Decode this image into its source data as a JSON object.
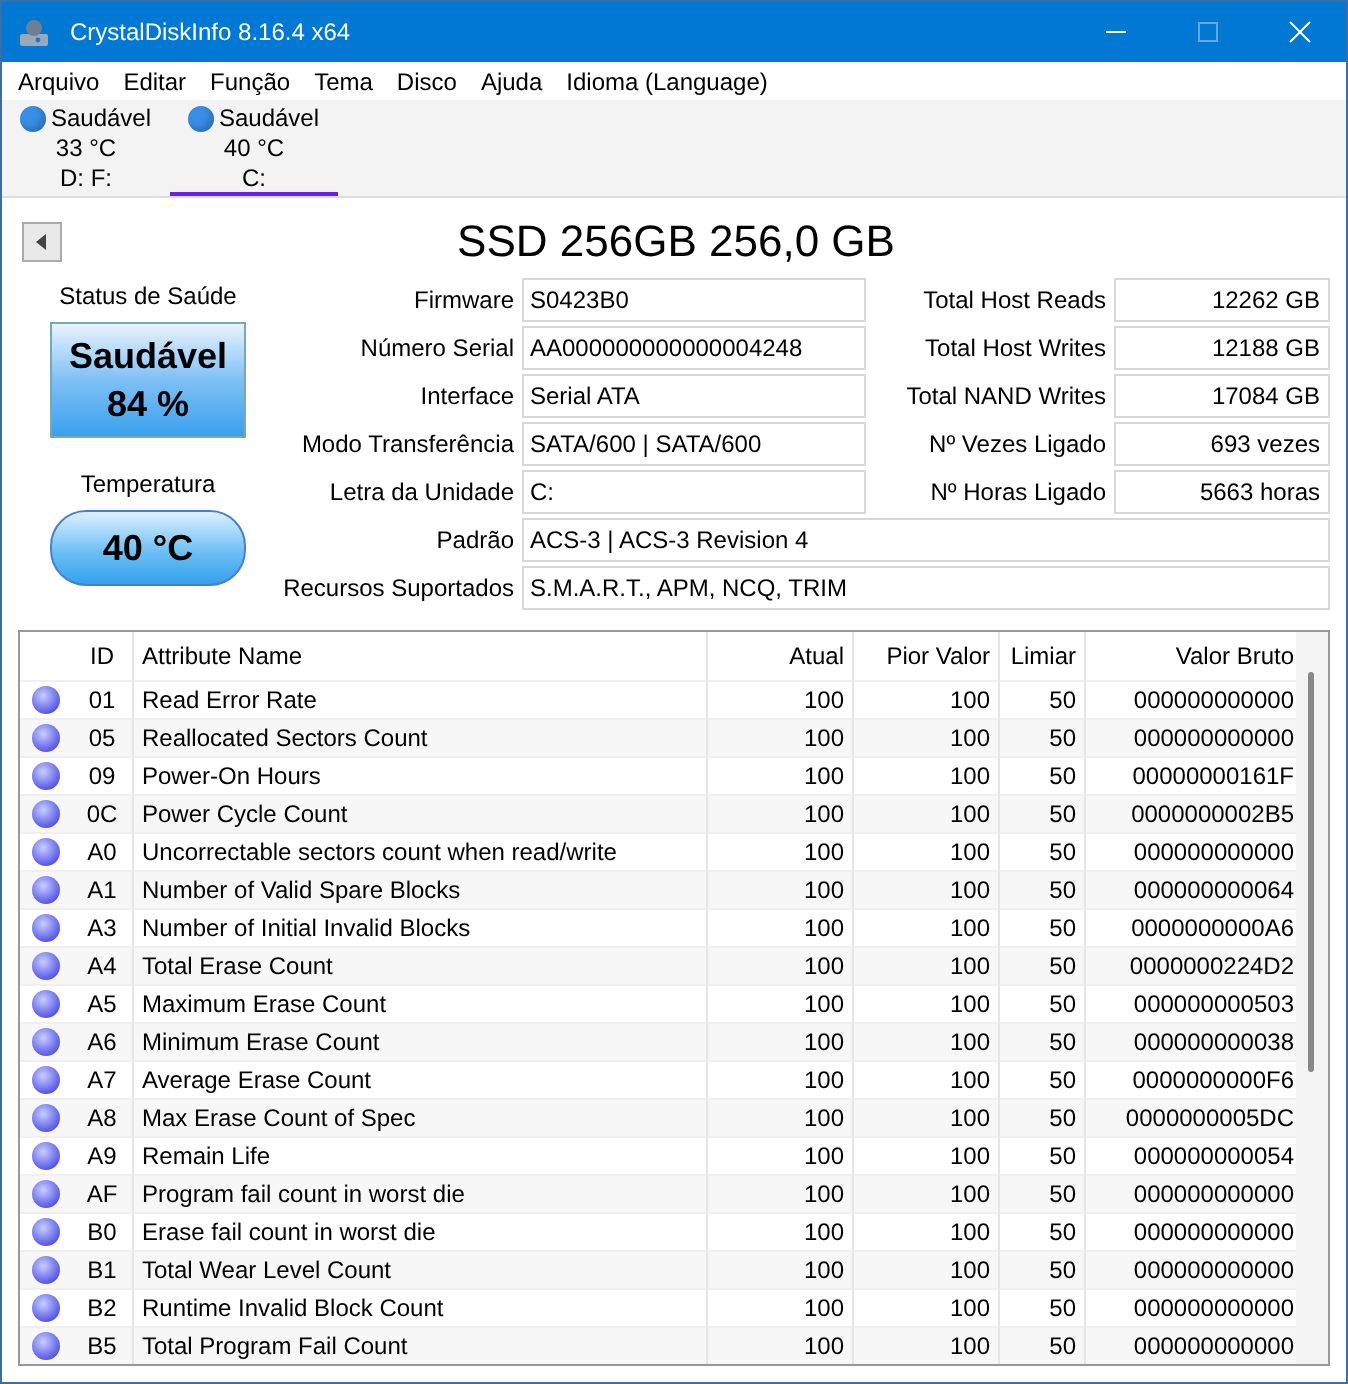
{
  "window": {
    "title": "CrystalDiskInfo 8.16.4 x64"
  },
  "menu": [
    "Arquivo",
    "Editar",
    "Função",
    "Tema",
    "Disco",
    "Ajuda",
    "Idioma (Language)"
  ],
  "drives": [
    {
      "status": "Saudável",
      "temperature": "33 °C",
      "letters": "D: F:",
      "color": "#3a8ee6",
      "selected": false
    },
    {
      "status": "Saudável",
      "temperature": "40 °C",
      "letters": "C:",
      "color": "#3a8ee6",
      "selected": true
    }
  ],
  "disk_title": "SSD 256GB 256,0 GB",
  "health": {
    "label": "Status de Saúde",
    "status": "Saudável",
    "percent": "84 %"
  },
  "temperature": {
    "label": "Temperatura",
    "value": "40 °C"
  },
  "info_left": [
    {
      "label": "Firmware",
      "value": "S0423B0"
    },
    {
      "label": "Número Serial",
      "value": "AA000000000000004248"
    },
    {
      "label": "Interface",
      "value": "Serial ATA"
    },
    {
      "label": "Modo Transferência",
      "value": "SATA/600 | SATA/600"
    },
    {
      "label": "Letra da Unidade",
      "value": "C:"
    }
  ],
  "info_right": [
    {
      "label": "Total Host Reads",
      "value": "12262 GB"
    },
    {
      "label": "Total Host Writes",
      "value": "12188 GB"
    },
    {
      "label": "Total NAND Writes",
      "value": "17084 GB"
    },
    {
      "label": "Nº Vezes Ligado",
      "value": "693 vezes"
    },
    {
      "label": "Nº Horas Ligado",
      "value": "5663 horas"
    }
  ],
  "info_wide": [
    {
      "label": "Padrão",
      "value": "ACS-3 | ACS-3 Revision 4"
    },
    {
      "label": "Recursos Suportados",
      "value": "S.M.A.R.T., APM, NCQ, TRIM"
    }
  ],
  "table": {
    "columns": [
      "ID",
      "Attribute Name",
      "Atual",
      "Pior Valor",
      "Limiar",
      "Valor Bruto"
    ],
    "rows": [
      [
        "01",
        "Read Error Rate",
        "100",
        "100",
        "50",
        "000000000000"
      ],
      [
        "05",
        "Reallocated Sectors Count",
        "100",
        "100",
        "50",
        "000000000000"
      ],
      [
        "09",
        "Power-On Hours",
        "100",
        "100",
        "50",
        "00000000161F"
      ],
      [
        "0C",
        "Power Cycle Count",
        "100",
        "100",
        "50",
        "0000000002B5"
      ],
      [
        "A0",
        "Uncorrectable sectors count when read/write",
        "100",
        "100",
        "50",
        "000000000000"
      ],
      [
        "A1",
        "Number of Valid Spare Blocks",
        "100",
        "100",
        "50",
        "000000000064"
      ],
      [
        "A3",
        "Number of Initial Invalid Blocks",
        "100",
        "100",
        "50",
        "0000000000A6"
      ],
      [
        "A4",
        "Total Erase Count",
        "100",
        "100",
        "50",
        "0000000224D2"
      ],
      [
        "A5",
        "Maximum Erase Count",
        "100",
        "100",
        "50",
        "000000000503"
      ],
      [
        "A6",
        "Minimum Erase Count",
        "100",
        "100",
        "50",
        "000000000038"
      ],
      [
        "A7",
        "Average Erase Count",
        "100",
        "100",
        "50",
        "0000000000F6"
      ],
      [
        "A8",
        "Max Erase Count of Spec",
        "100",
        "100",
        "50",
        "0000000005DC"
      ],
      [
        "A9",
        "Remain Life",
        "100",
        "100",
        "50",
        "000000000054"
      ],
      [
        "AF",
        "Program fail count in worst die",
        "100",
        "100",
        "50",
        "000000000000"
      ],
      [
        "B0",
        "Erase fail count in worst die",
        "100",
        "100",
        "50",
        "000000000000"
      ],
      [
        "B1",
        "Total Wear Level Count",
        "100",
        "100",
        "50",
        "000000000000"
      ],
      [
        "B2",
        "Runtime Invalid Block Count",
        "100",
        "100",
        "50",
        "000000000000"
      ],
      [
        "B5",
        "Total Program Fail Count",
        "100",
        "100",
        "50",
        "000000000000"
      ]
    ]
  }
}
